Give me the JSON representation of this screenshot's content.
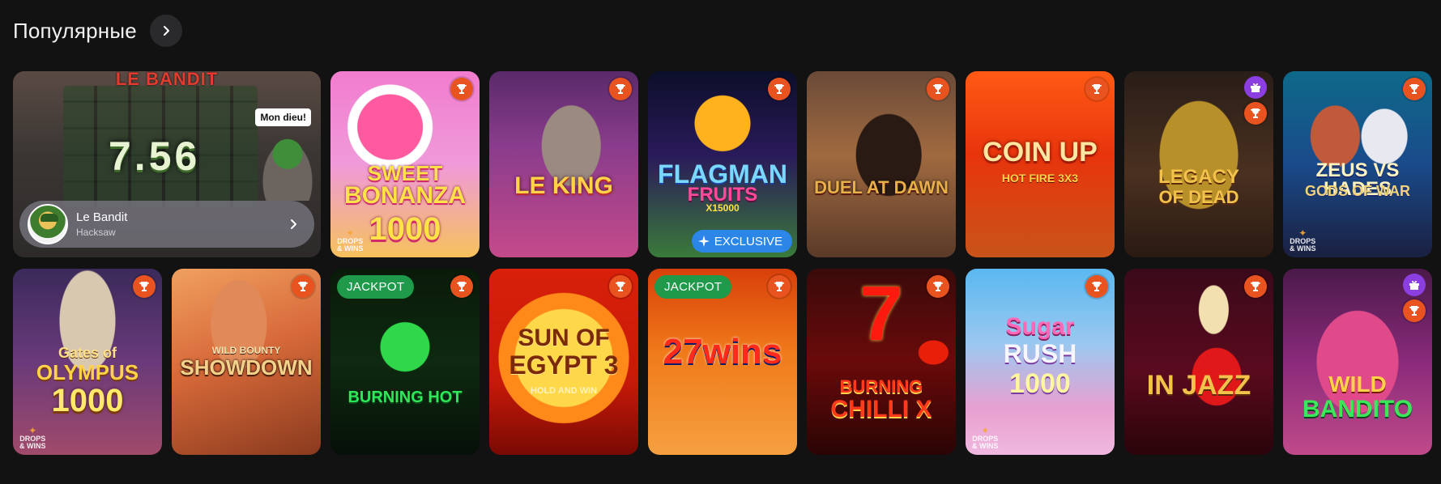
{
  "section": {
    "title": "Популярные",
    "more_icon": "chevron-right-icon"
  },
  "featured": {
    "name": "Le Bandit",
    "provider": "Hacksaw",
    "logo_text": "LE BANDIT",
    "multiplier": "7.56",
    "speech": "Mon dieu!"
  },
  "badges": {
    "jackpot": "JACKPOT",
    "exclusive": "EXCLUSIVE",
    "drops_line1": "DROPS",
    "drops_line2": "& WINS"
  },
  "games": [
    {
      "id": "sweet-bonanza-1000",
      "line1": "SWEET",
      "line2": "BONANZA",
      "line3": "1000"
    },
    {
      "id": "le-king",
      "line1": "LE KING"
    },
    {
      "id": "flagman-fruits",
      "line1": "FLAGMAN",
      "line2": "FRUITS",
      "line3": "X15000"
    },
    {
      "id": "duel-at-dawn",
      "line1": "DUEL AT DAWN"
    },
    {
      "id": "coin-up-hot-fire",
      "line1": "COIN UP",
      "line2": "HOT FIRE 3X3"
    },
    {
      "id": "legacy-of-dead",
      "line1": "LEGACY",
      "line2": "OF DEAD"
    },
    {
      "id": "zeus-vs-hades",
      "line1": "ZEUS VS HADES",
      "line2": "GODS OF WAR"
    },
    {
      "id": "gates-of-olympus-1000",
      "line1": "Gates of",
      "line2": "OLYMPUS",
      "line3": "1000"
    },
    {
      "id": "wild-bounty-showdown",
      "line1": "WILD BOUNTY",
      "line2": "SHOWDOWN"
    },
    {
      "id": "burning-hot",
      "line1": "BURNING HOT"
    },
    {
      "id": "sun-of-egypt-3",
      "line1": "SUN OF",
      "line2": "EGYPT 3",
      "line3": "HOLD AND WIN"
    },
    {
      "id": "27-wins",
      "line1": "27wins"
    },
    {
      "id": "burning-chilli-x",
      "line1": "7",
      "line2": "BURNING",
      "line3": "CHILLI X"
    },
    {
      "id": "sugar-rush-1000",
      "line1": "Sugar",
      "line2": "RUSH",
      "line3": "1000"
    },
    {
      "id": "in-jazz",
      "line1": "IN JAZZ"
    },
    {
      "id": "wild-bandito",
      "line1": "WILD",
      "line2": "BANDITO"
    }
  ],
  "colors": {
    "background": "#121212",
    "trophy_badge": "#e8531f",
    "gift_badge": "#8b3fe0",
    "jackpot_badge": "#1f9a4a",
    "exclusive_badge": "#2c86e8"
  },
  "icons": {
    "trophy": "trophy-icon",
    "gift": "gift-icon",
    "sparkle": "sparkle-icon",
    "chevron": "chevron-right-icon"
  }
}
